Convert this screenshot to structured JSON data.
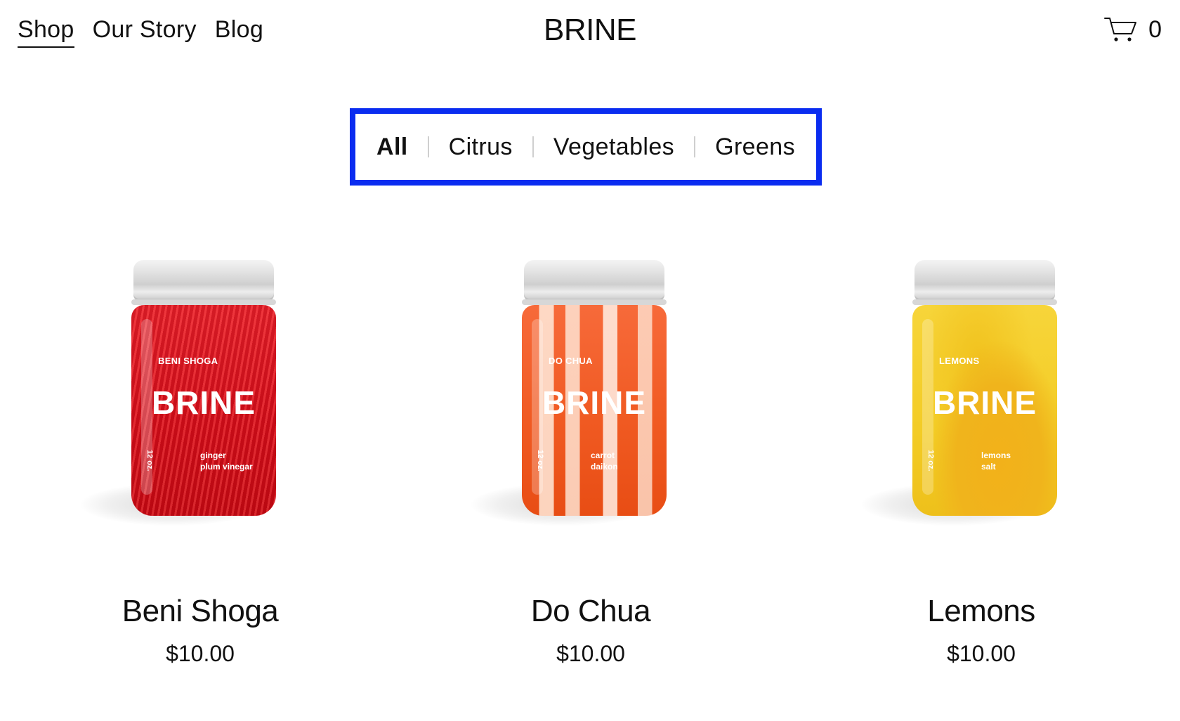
{
  "nav": {
    "items": [
      {
        "label": "Shop",
        "active": true
      },
      {
        "label": "Our Story",
        "active": false
      },
      {
        "label": "Blog",
        "active": false
      }
    ]
  },
  "brand": "BRINE",
  "cart": {
    "icon": "cart-icon",
    "count": "0"
  },
  "filter": {
    "highlight_color": "#0a2cf0",
    "categories": [
      {
        "label": "All",
        "selected": true
      },
      {
        "label": "Citrus",
        "selected": false
      },
      {
        "label": "Vegetables",
        "selected": false
      },
      {
        "label": "Greens",
        "selected": false
      }
    ]
  },
  "products": [
    {
      "name": "Beni Shoga",
      "price": "$10.00",
      "jar": {
        "title": "BENI SHOGA",
        "brand": "BRINE",
        "size": "12 oz.",
        "ingredients": [
          "ginger",
          "plum vinegar"
        ],
        "color": "#d3101c"
      }
    },
    {
      "name": "Do Chua",
      "price": "$10.00",
      "jar": {
        "title": "DO CHUA",
        "brand": "BRINE",
        "size": "12 oz.",
        "ingredients": [
          "carrot",
          "daikon"
        ],
        "color": "#f05a22"
      }
    },
    {
      "name": "Lemons",
      "price": "$10.00",
      "jar": {
        "title": "LEMONS",
        "brand": "BRINE",
        "size": "12 oz.",
        "ingredients": [
          "lemons",
          "salt"
        ],
        "color": "#f3cc25"
      }
    }
  ]
}
